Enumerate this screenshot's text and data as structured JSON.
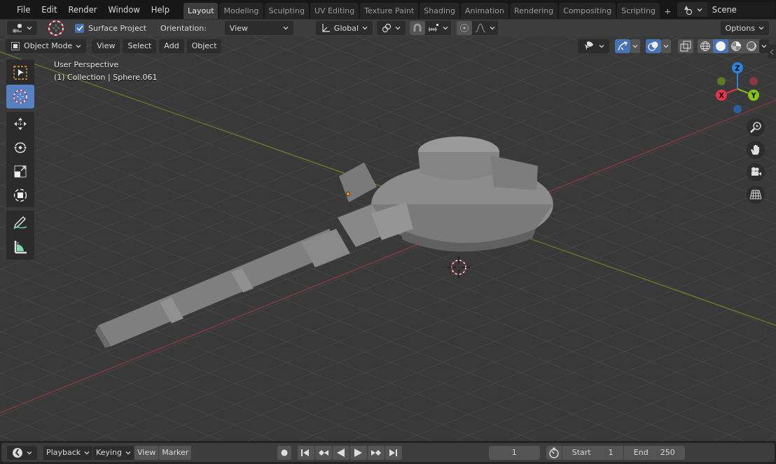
{
  "menu": [
    "File",
    "Edit",
    "Render",
    "Window",
    "Help"
  ],
  "workspace_tabs": [
    {
      "label": "Layout",
      "selected": true
    },
    {
      "label": "Modeling",
      "selected": false
    },
    {
      "label": "Sculpting",
      "selected": false
    },
    {
      "label": "UV Editing",
      "selected": false
    },
    {
      "label": "Texture Paint",
      "selected": false
    },
    {
      "label": "Shading",
      "selected": false
    },
    {
      "label": "Animation",
      "selected": false
    },
    {
      "label": "Rendering",
      "selected": false
    },
    {
      "label": "Compositing",
      "selected": false
    },
    {
      "label": "Scripting",
      "selected": false
    }
  ],
  "add_workspace": "+",
  "scene": "Scene",
  "tool_settings": {
    "surface_project": {
      "label": "Surface Project",
      "checked": true
    },
    "orientation_label": "Orientation:",
    "orientation": "View",
    "transform_orientation": "Global",
    "options": "Options"
  },
  "viewport_header": {
    "mode": "Object Mode",
    "menus": [
      "View",
      "Select",
      "Add",
      "Object"
    ],
    "gizmos_on": true,
    "overlays_on": true,
    "shading": [
      {
        "kind": "wireframe",
        "selected": false
      },
      {
        "kind": "solid",
        "selected": true
      },
      {
        "kind": "material",
        "selected": false
      },
      {
        "kind": "rendered",
        "selected": false
      }
    ]
  },
  "viewport": {
    "view_name": "User Perspective",
    "object_info": "(1) Collection | Sphere.061",
    "tools": [
      {
        "kind": "select",
        "selected": false
      },
      {
        "kind": "cursor",
        "selected": true
      },
      {
        "kind": "move",
        "selected": false
      },
      {
        "kind": "rotate",
        "selected": false
      },
      {
        "kind": "scale",
        "selected": false
      },
      {
        "kind": "transform",
        "selected": false
      },
      {
        "kind": "annotate",
        "selected": false
      },
      {
        "kind": "measure",
        "selected": false
      }
    ],
    "gizmo_axes": [
      {
        "label": "Z",
        "color": "#2f83e0"
      },
      {
        "label": "X",
        "color": "#e8334a"
      },
      {
        "label": "Y",
        "color": "#88c21a"
      }
    ]
  },
  "timeline": {
    "menus": [
      {
        "label": "Playback",
        "dropdown": true
      },
      {
        "label": "Keying",
        "dropdown": true
      },
      {
        "label": "View",
        "dropdown": false
      },
      {
        "label": "Marker",
        "dropdown": false
      }
    ],
    "current_frame": "1",
    "start_label": "Start",
    "start": "1",
    "end_label": "End",
    "end": "250"
  }
}
